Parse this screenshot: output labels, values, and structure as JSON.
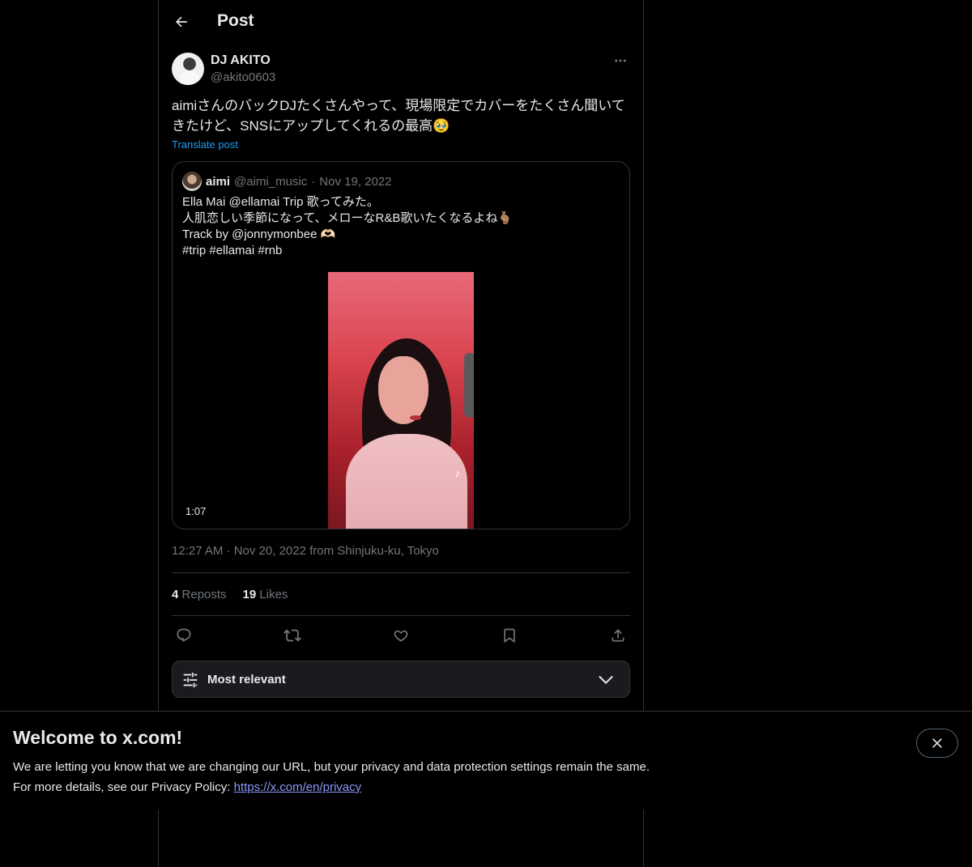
{
  "header": {
    "title": "Post"
  },
  "post": {
    "author": {
      "name": "DJ AKITO",
      "handle": "@akito0603"
    },
    "text": "aimiさんのバックDJたくさんやって、現場限定でカバーをたくさん聞いてきたけど、SNSにアップしてくれるの最高🥹",
    "translate_label": "Translate post",
    "timestamp": "12:27 AM · Nov 20, 2022 from Shinjuku-ku, Tokyo",
    "stats": {
      "reposts_count": "4",
      "reposts_label": "Reposts",
      "likes_count": "19",
      "likes_label": "Likes"
    }
  },
  "quote": {
    "name": "aimi",
    "handle": "@aimi_music",
    "separator": "·",
    "date": "Nov 19, 2022",
    "text": "Ella Mai @ellamai Trip 歌ってみた。\n人肌恋しい季節になって、メローなR&B歌いたくなるよね🫰🏽\nTrack by @jonnymonbee 🫶🏻\n#trip #ellamai #rnb",
    "video_duration": "1:07"
  },
  "sort": {
    "label": "Most relevant"
  },
  "banner": {
    "title": "Welcome to x.com!",
    "line1": "We are letting you know that we are changing our URL, but your privacy and data protection settings remain the same.",
    "line2_prefix": "For more details, see our Privacy Policy: ",
    "link_text": "https://x.com/en/privacy"
  },
  "icons": {
    "back": "arrow-left-icon",
    "more": "more-horizontal-icon",
    "reply": "reply-icon",
    "repost": "repost-icon",
    "like": "heart-icon",
    "bookmark": "bookmark-icon",
    "share": "share-icon",
    "sort": "sliders-icon",
    "chevron": "chevron-down-icon",
    "close": "close-icon"
  },
  "colors": {
    "background": "#000000",
    "text": "#e7e9ea",
    "muted": "#71767b",
    "link": "#1d9bf0",
    "border": "#2f3336"
  }
}
